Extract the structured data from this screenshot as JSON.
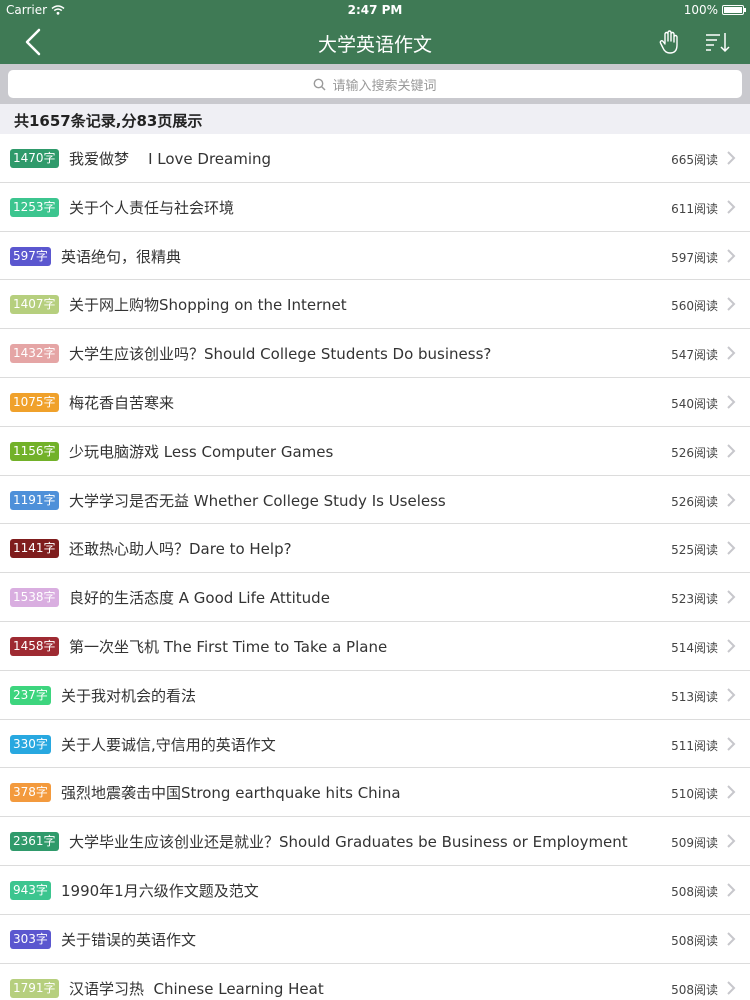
{
  "status_bar": {
    "carrier": "Carrier",
    "time": "2:47 PM",
    "battery": "100%"
  },
  "nav": {
    "title": "大学英语作文",
    "back_icon": "chevron-left-icon",
    "hand_icon": "hand-icon",
    "sort_icon": "sort-icon"
  },
  "search": {
    "placeholder": "请输入搜索关键词"
  },
  "summary": "共1657条记录,分83页展示",
  "colors": {
    "nav_green": "#3f7a55",
    "search_bg": "#c9c9ce",
    "summary_bg": "#efeff4"
  },
  "items": [
    {
      "badge": "1470字",
      "color": "#2f9a6b",
      "title": "我爱做梦    I Love Dreaming",
      "reads": "665阅读"
    },
    {
      "badge": "1253字",
      "color": "#3cc58f",
      "title": "关于个人责任与社会环境",
      "reads": "611阅读"
    },
    {
      "badge": "597字",
      "color": "#5b57cf",
      "title": "英语绝句，很精典",
      "reads": "597阅读"
    },
    {
      "badge": "1407字",
      "color": "#b6cf7e",
      "title": "关于网上购物Shopping on the Internet",
      "reads": "560阅读"
    },
    {
      "badge": "1432字",
      "color": "#e5a5a5",
      "title": "大学生应该创业吗？Should College Students Do business?",
      "reads": "547阅读"
    },
    {
      "badge": "1075字",
      "color": "#f0a12b",
      "title": "梅花香自苦寒来",
      "reads": "540阅读"
    },
    {
      "badge": "1156字",
      "color": "#72b129",
      "title": "少玩电脑游戏 Less Computer Games",
      "reads": "526阅读"
    },
    {
      "badge": "1191字",
      "color": "#4e90d9",
      "title": "大学学习是否无益 Whether College Study Is Useless",
      "reads": "526阅读"
    },
    {
      "badge": "1141字",
      "color": "#7f1d1d",
      "title": "还敢热心助人吗？Dare to Help?",
      "reads": "525阅读"
    },
    {
      "badge": "1538字",
      "color": "#d9aee0",
      "title": "良好的生活态度 A Good Life Attitude",
      "reads": "523阅读"
    },
    {
      "badge": "1458字",
      "color": "#9e2a32",
      "title": "第一次坐飞机 The First Time to Take a Plane",
      "reads": "514阅读"
    },
    {
      "badge": "237字",
      "color": "#3dd57e",
      "title": "关于我对机会的看法",
      "reads": "513阅读"
    },
    {
      "badge": "330字",
      "color": "#28a8e0",
      "title": "关于人要诚信,守信用的英语作文",
      "reads": "511阅读"
    },
    {
      "badge": "378字",
      "color": "#f39a3d",
      "title": "强烈地震袭击中国Strong earthquake hits China",
      "reads": "510阅读"
    },
    {
      "badge": "2361字",
      "color": "#2f9a6b",
      "title": "大学毕业生应该创业还是就业？Should Graduates be Business or Employment",
      "reads": "509阅读"
    },
    {
      "badge": "943字",
      "color": "#3cc58f",
      "title": "1990年1月六级作文题及范文",
      "reads": "508阅读"
    },
    {
      "badge": "303字",
      "color": "#5b57cf",
      "title": "关于错误的英语作文",
      "reads": "508阅读"
    },
    {
      "badge": "1791字",
      "color": "#b6cf7e",
      "title": "汉语学习热  Chinese Learning Heat",
      "reads": "508阅读"
    }
  ]
}
